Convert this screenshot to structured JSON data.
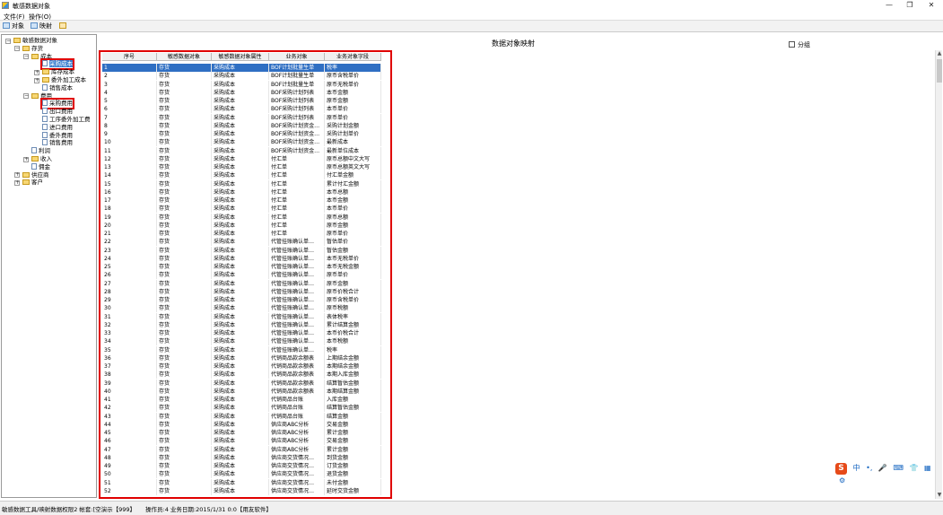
{
  "window": {
    "title": "敏感数据对象"
  },
  "menu": [
    "文件(F)",
    "操作(O)"
  ],
  "toolbar": {
    "object_label": "对象",
    "mapping_label": "映射"
  },
  "tree": [
    {
      "label": "敏感数据对象",
      "toggle": "−",
      "level": 0,
      "icon": "folder"
    },
    {
      "label": "存货",
      "toggle": "−",
      "level": 1,
      "icon": "folder"
    },
    {
      "label": "成本",
      "toggle": "−",
      "level": 2,
      "icon": "folder"
    },
    {
      "label": "采购成本",
      "toggle": "",
      "level": 3,
      "icon": "doc",
      "selected": true,
      "highlight": true
    },
    {
      "label": "库存成本",
      "toggle": "+",
      "level": 3,
      "icon": "folder"
    },
    {
      "label": "委外加工成本",
      "toggle": "+",
      "level": 3,
      "icon": "folder"
    },
    {
      "label": "销售成本",
      "toggle": "",
      "level": 3,
      "icon": "doc"
    },
    {
      "label": "费用",
      "toggle": "−",
      "level": 2,
      "icon": "folder"
    },
    {
      "label": "采购费用",
      "toggle": "",
      "level": 3,
      "icon": "doc",
      "highlight": true
    },
    {
      "label": "出口费用",
      "toggle": "",
      "level": 3,
      "icon": "doc"
    },
    {
      "label": "工序委外加工费",
      "toggle": "",
      "level": 3,
      "icon": "doc"
    },
    {
      "label": "进口费用",
      "toggle": "",
      "level": 3,
      "icon": "doc"
    },
    {
      "label": "委外费用",
      "toggle": "",
      "level": 3,
      "icon": "doc"
    },
    {
      "label": "销售费用",
      "toggle": "",
      "level": 3,
      "icon": "doc"
    },
    {
      "label": "利润",
      "toggle": "",
      "level": 2,
      "icon": "doc"
    },
    {
      "label": "收入",
      "toggle": "+",
      "level": 2,
      "icon": "folder"
    },
    {
      "label": "佣金",
      "toggle": "",
      "level": 2,
      "icon": "doc"
    },
    {
      "label": "供应商",
      "toggle": "+",
      "level": 1,
      "icon": "folder"
    },
    {
      "label": "客户",
      "toggle": "+",
      "level": 1,
      "icon": "folder"
    }
  ],
  "panel": {
    "title": "数据对象映射",
    "group_label": "分组"
  },
  "grid": {
    "columns": [
      "序号",
      "敏感数据对象",
      "敏感数据对象属性",
      "业务对象",
      "业务对象字段"
    ],
    "rows": [
      [
        "1",
        "存货",
        "采购成本",
        "BOF计划批量生单",
        "税率"
      ],
      [
        "2",
        "存货",
        "采购成本",
        "BOF计划批量生单",
        "原币含税单价"
      ],
      [
        "3",
        "存货",
        "采购成本",
        "BOF计划批量生单",
        "原币无税单价"
      ],
      [
        "4",
        "存货",
        "采购成本",
        "BOF采购计划列表",
        "本币金额"
      ],
      [
        "5",
        "存货",
        "采购成本",
        "BOF采购计划列表",
        "原币金额"
      ],
      [
        "6",
        "存货",
        "采购成本",
        "BOF采购计划列表",
        "本币单价"
      ],
      [
        "7",
        "存货",
        "采购成本",
        "BOF采购计划列表",
        "原币单价"
      ],
      [
        "8",
        "存货",
        "采购成本",
        "BOF采购计划资金…",
        "采购计划金额"
      ],
      [
        "9",
        "存货",
        "采购成本",
        "BOF采购计划资金…",
        "采购计划单价"
      ],
      [
        "10",
        "存货",
        "采购成本",
        "BOF采购计划资金…",
        "最新成本"
      ],
      [
        "11",
        "存货",
        "采购成本",
        "BOF采购计划资金…",
        "最新单位成本"
      ],
      [
        "12",
        "存货",
        "采购成本",
        "付汇单",
        "原币总额中文大写"
      ],
      [
        "13",
        "存货",
        "采购成本",
        "付汇单",
        "原币总额英文大写"
      ],
      [
        "14",
        "存货",
        "采购成本",
        "付汇单",
        "付汇单金额"
      ],
      [
        "15",
        "存货",
        "采购成本",
        "付汇单",
        "累计付汇金额"
      ],
      [
        "16",
        "存货",
        "采购成本",
        "付汇单",
        "本币总额"
      ],
      [
        "17",
        "存货",
        "采购成本",
        "付汇单",
        "本币金额"
      ],
      [
        "18",
        "存货",
        "采购成本",
        "付汇单",
        "本币单价"
      ],
      [
        "19",
        "存货",
        "采购成本",
        "付汇单",
        "原币总额"
      ],
      [
        "20",
        "存货",
        "采购成本",
        "付汇单",
        "原币金额"
      ],
      [
        "21",
        "存货",
        "采购成本",
        "付汇单",
        "原币单价"
      ],
      [
        "22",
        "存货",
        "采购成本",
        "代管挂账确认单…",
        "暂估单价"
      ],
      [
        "23",
        "存货",
        "采购成本",
        "代管挂账确认单…",
        "暂估金额"
      ],
      [
        "24",
        "存货",
        "采购成本",
        "代管挂账确认单…",
        "本币无税单价"
      ],
      [
        "25",
        "存货",
        "采购成本",
        "代管挂账确认单…",
        "本币无税金额"
      ],
      [
        "26",
        "存货",
        "采购成本",
        "代管挂账确认单…",
        "原币单价"
      ],
      [
        "27",
        "存货",
        "采购成本",
        "代管挂账确认单…",
        "原币金额"
      ],
      [
        "28",
        "存货",
        "采购成本",
        "代管挂账确认单…",
        "原币价税合计"
      ],
      [
        "29",
        "存货",
        "采购成本",
        "代管挂账确认单…",
        "原币含税单价"
      ],
      [
        "30",
        "存货",
        "采购成本",
        "代管挂账确认单…",
        "原币税额"
      ],
      [
        "31",
        "存货",
        "采购成本",
        "代管挂账确认单…",
        "表体税率"
      ],
      [
        "32",
        "存货",
        "采购成本",
        "代管挂账确认单…",
        "累计结算金额"
      ],
      [
        "33",
        "存货",
        "采购成本",
        "代管挂账确认单…",
        "本币价税合计"
      ],
      [
        "34",
        "存货",
        "采购成本",
        "代管挂账确认单…",
        "本币税额"
      ],
      [
        "35",
        "存货",
        "采购成本",
        "代管挂账确认单…",
        "税率"
      ],
      [
        "36",
        "存货",
        "采购成本",
        "代销商品款余额表",
        "上期结余金额"
      ],
      [
        "37",
        "存货",
        "采购成本",
        "代销商品款余额表",
        "本期结余金额"
      ],
      [
        "38",
        "存货",
        "采购成本",
        "代销商品款余额表",
        "本期入库金额"
      ],
      [
        "39",
        "存货",
        "采购成本",
        "代销商品款余额表",
        "结算暂估金额"
      ],
      [
        "40",
        "存货",
        "采购成本",
        "代销商品款余额表",
        "本期结算金额"
      ],
      [
        "41",
        "存货",
        "采购成本",
        "代销商品台账",
        "入库金额"
      ],
      [
        "42",
        "存货",
        "采购成本",
        "代销商品台账",
        "结算暂估金额"
      ],
      [
        "43",
        "存货",
        "采购成本",
        "代销商品台账",
        "结算金额"
      ],
      [
        "44",
        "存货",
        "采购成本",
        "供应商ABC分析",
        "交易金额"
      ],
      [
        "45",
        "存货",
        "采购成本",
        "供应商ABC分析",
        "累计金额"
      ],
      [
        "46",
        "存货",
        "采购成本",
        "供应商ABC分析",
        "交易金额"
      ],
      [
        "47",
        "存货",
        "采购成本",
        "供应商ABC分析",
        "累计金额"
      ],
      [
        "48",
        "存货",
        "采购成本",
        "供应商交货情况…",
        "到货金额"
      ],
      [
        "49",
        "存货",
        "采购成本",
        "供应商交货情况…",
        "订货金额"
      ],
      [
        "50",
        "存货",
        "采购成本",
        "供应商交货情况…",
        "退货金额"
      ],
      [
        "51",
        "存货",
        "采购成本",
        "供应商交货情况…",
        "未付金额"
      ],
      [
        "52",
        "存货",
        "采购成本",
        "供应商交货情况…",
        "延时交货金额"
      ]
    ],
    "selected_row": 0
  },
  "status": {
    "left": "敏感数据工具/映射数据权限2 帐套:[空演示【999】",
    "right": "操作员:4 业务日期:2015/1/31 0:0【用友软件】"
  },
  "ime": {
    "logo": "S",
    "lang": "中"
  }
}
